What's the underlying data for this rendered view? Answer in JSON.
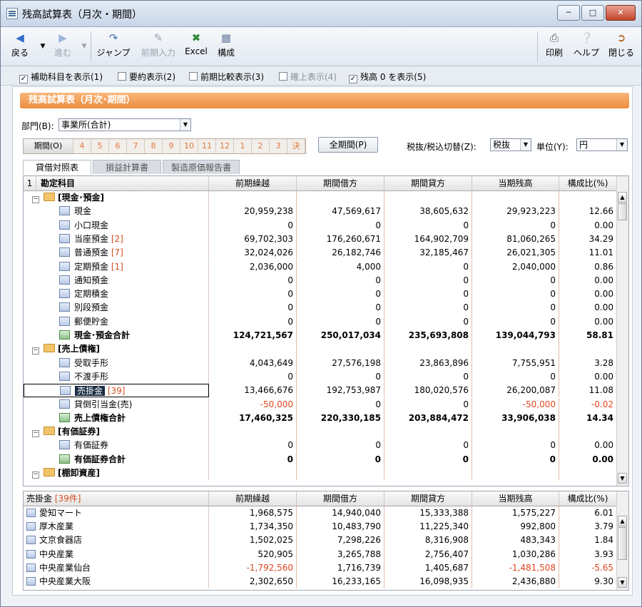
{
  "window": {
    "title": "残高試算表（月次・期間）"
  },
  "toolbar": {
    "back": "戻る",
    "forward": "進む",
    "jump": "ジャンプ",
    "prev_input": "前期入力",
    "excel": "Excel",
    "config": "構成",
    "print": "印刷",
    "help": "ヘルプ",
    "close": "閉じる"
  },
  "options": [
    {
      "label": "補助科目を表示(1)",
      "checked": true,
      "enabled": true
    },
    {
      "label": "要約表示(2)",
      "checked": false,
      "enabled": true
    },
    {
      "label": "前期比較表示(3)",
      "checked": false,
      "enabled": true
    },
    {
      "label": "確上表示(4)",
      "checked": false,
      "enabled": false
    },
    {
      "label": "残高 0 を表示(5)",
      "checked": true,
      "enabled": true
    }
  ],
  "panel": {
    "title": "残高試算表（月次･期間）"
  },
  "filters": {
    "dept_label": "部門(B):",
    "dept_value": "事業所(合計)",
    "tax_label": "税抜/税込切替(Z):",
    "tax_value": "税抜",
    "unit_label": "単位(Y):",
    "unit_value": "円",
    "all_period": "全期間(P)"
  },
  "periods": [
    "期間(O)",
    "4",
    "5",
    "6",
    "7",
    "8",
    "9",
    "10",
    "11",
    "12",
    "1",
    "2",
    "3",
    "決"
  ],
  "tabs": [
    "貸借対照表",
    "損益計算書",
    "製造原価報告書"
  ],
  "main_table": {
    "headers": [
      "1",
      "勘定科目",
      "前期繰越",
      "期間借方",
      "期間貸方",
      "当期残高",
      "構成比(%)"
    ],
    "rows": [
      {
        "type": "group",
        "name": "[現金･預金]"
      },
      {
        "type": "item",
        "name": "現金",
        "cnt": "",
        "v": [
          "20,959,238",
          "47,569,617",
          "38,605,632",
          "29,923,223",
          "12.66"
        ]
      },
      {
        "type": "item",
        "name": "小口現金",
        "cnt": "",
        "v": [
          "0",
          "0",
          "0",
          "0",
          "0.00"
        ]
      },
      {
        "type": "item",
        "name": "当座預金",
        "cnt": "[2]",
        "v": [
          "69,702,303",
          "176,260,671",
          "164,902,709",
          "81,060,265",
          "34.29"
        ]
      },
      {
        "type": "item",
        "name": "普通預金",
        "cnt": "[7]",
        "v": [
          "32,024,026",
          "26,182,746",
          "32,185,467",
          "26,021,305",
          "11.01"
        ]
      },
      {
        "type": "item",
        "name": "定期預金",
        "cnt": "[1]",
        "v": [
          "2,036,000",
          "4,000",
          "0",
          "2,040,000",
          "0.86"
        ]
      },
      {
        "type": "item",
        "name": "通知預金",
        "cnt": "",
        "v": [
          "0",
          "0",
          "0",
          "0",
          "0.00"
        ]
      },
      {
        "type": "item",
        "name": "定期積金",
        "cnt": "",
        "v": [
          "0",
          "0",
          "0",
          "0",
          "0.00"
        ]
      },
      {
        "type": "item",
        "name": "別段預金",
        "cnt": "",
        "v": [
          "0",
          "0",
          "0",
          "0",
          "0.00"
        ]
      },
      {
        "type": "item",
        "name": "郵便貯金",
        "cnt": "",
        "v": [
          "0",
          "0",
          "0",
          "0",
          "0.00"
        ]
      },
      {
        "type": "total",
        "name": "現金･預金合計",
        "cnt": "",
        "v": [
          "124,721,567",
          "250,017,034",
          "235,693,808",
          "139,044,793",
          "58.81"
        ]
      },
      {
        "type": "group",
        "name": "[売上債権]"
      },
      {
        "type": "item",
        "name": "受取手形",
        "cnt": "",
        "v": [
          "4,043,649",
          "27,576,198",
          "23,863,896",
          "7,755,951",
          "3.28"
        ]
      },
      {
        "type": "item",
        "name": "不渡手形",
        "cnt": "",
        "v": [
          "0",
          "0",
          "0",
          "0",
          "0.00"
        ]
      },
      {
        "type": "sel",
        "name": "売掛金",
        "cnt": "[39]",
        "v": [
          "13,466,676",
          "192,753,987",
          "180,020,576",
          "26,200,087",
          "11.08"
        ]
      },
      {
        "type": "item",
        "name": "貸倒引当金(売)",
        "cnt": "",
        "v": [
          "-50,000",
          "0",
          "0",
          "-50,000",
          "-0.02"
        ]
      },
      {
        "type": "total",
        "name": "売上債権合計",
        "cnt": "",
        "v": [
          "17,460,325",
          "220,330,185",
          "203,884,472",
          "33,906,038",
          "14.34"
        ]
      },
      {
        "type": "group",
        "name": "[有価証券]"
      },
      {
        "type": "item",
        "name": "有価証券",
        "cnt": "",
        "v": [
          "0",
          "0",
          "0",
          "0",
          "0.00"
        ]
      },
      {
        "type": "total",
        "name": "有価証券合計",
        "cnt": "",
        "v": [
          "0",
          "0",
          "0",
          "0",
          "0.00"
        ]
      },
      {
        "type": "group",
        "name": "[棚卸資産]"
      }
    ]
  },
  "detail_table": {
    "title": "売掛金",
    "count": "[39件]",
    "headers": [
      "前期繰越",
      "期間借方",
      "期間貸方",
      "当期残高",
      "構成比(%)"
    ],
    "rows": [
      {
        "name": "愛知マート",
        "v": [
          "1,968,575",
          "14,940,040",
          "15,333,388",
          "1,575,227",
          "6.01"
        ]
      },
      {
        "name": "厚木産業",
        "v": [
          "1,734,350",
          "10,483,790",
          "11,225,340",
          "992,800",
          "3.79"
        ]
      },
      {
        "name": "文京食器店",
        "v": [
          "1,502,025",
          "7,298,226",
          "8,316,908",
          "483,343",
          "1.84"
        ]
      },
      {
        "name": "中央産業",
        "v": [
          "520,905",
          "3,265,788",
          "2,756,407",
          "1,030,286",
          "3.93"
        ]
      },
      {
        "name": "中央産業仙台",
        "v": [
          "-1,792,560",
          "1,716,739",
          "1,405,687",
          "-1,481,508",
          "-5.65"
        ]
      },
      {
        "name": "中央産業大阪",
        "v": [
          "2,302,650",
          "16,233,165",
          "16,098,935",
          "2,436,880",
          "9.30"
        ]
      }
    ]
  },
  "colors": {
    "banner": "#ec8d3f",
    "negative": "#e0461f",
    "selected": "#1b2d44"
  }
}
